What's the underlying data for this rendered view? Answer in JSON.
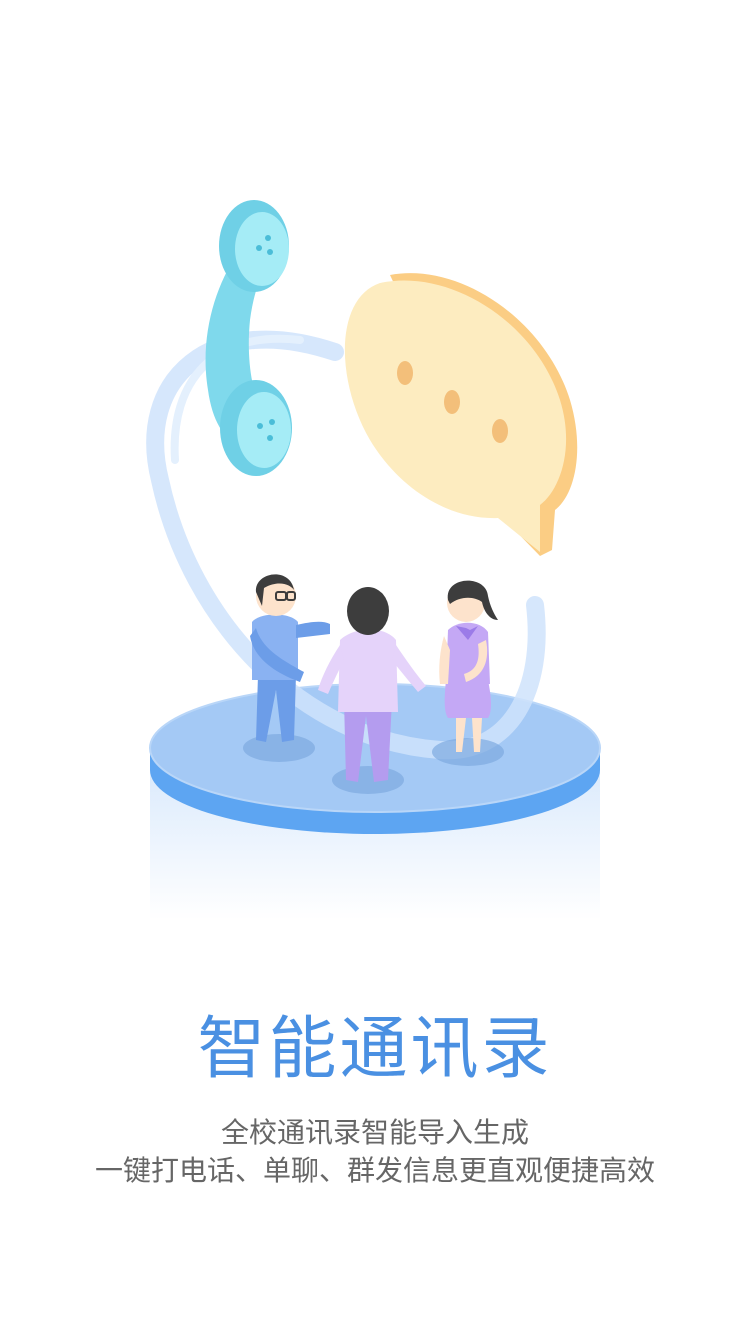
{
  "illustration": {
    "phone_icon": "telephone-handset-icon",
    "chat_icon": "chat-bubble-icon",
    "people": [
      "person-with-glasses",
      "person-back-view",
      "person-girl"
    ],
    "colors": {
      "phone": "#7fd9ec",
      "bubble": "#fde9b3",
      "platform": "#9ec6f3",
      "platform_edge": "#5da5f2"
    }
  },
  "intro": {
    "title": "智能通讯录",
    "subtitle_line1": "全校通讯录智能导入生成",
    "subtitle_line2": "一键打电话、单聊、群发信息更直观便捷高效"
  },
  "colors": {
    "title": "#4a90e2",
    "subtitle": "#666666",
    "background": "#ffffff"
  }
}
